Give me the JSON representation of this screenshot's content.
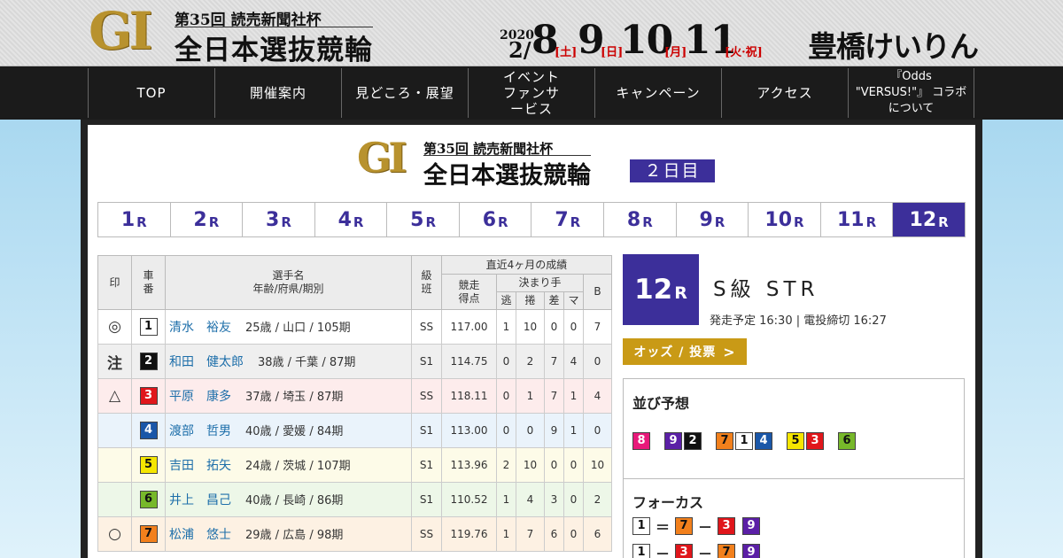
{
  "banner": {
    "gi": "GI",
    "subtitle": "第35回 読売新聞社杯",
    "title": "全日本選抜競輪",
    "year": "2020",
    "month": "2/",
    "dates": [
      {
        "num": "8",
        "day": "[土]"
      },
      {
        "num": "9",
        "day": "[日]"
      },
      {
        "num": "10",
        "day": "[月]"
      },
      {
        "num": "11",
        "day": "[火·祝]"
      }
    ],
    "brand": "豊橋けいりん"
  },
  "nav": [
    {
      "label": "TOP"
    },
    {
      "label": "開催案内"
    },
    {
      "label": "見どころ・展望"
    },
    {
      "label": "イベント ファンサービス"
    },
    {
      "label": "キャンペーン"
    },
    {
      "label": "アクセス"
    },
    {
      "label": "『Odds \"VERSUS!\"』 コラボについて"
    }
  ],
  "header": {
    "gi": "GI",
    "subtitle": "第35回 読売新聞社杯",
    "title": "全日本選抜競輪",
    "day_badge": "２日目"
  },
  "race_tabs": [
    {
      "n": "1",
      "r": "R"
    },
    {
      "n": "2",
      "r": "R"
    },
    {
      "n": "3",
      "r": "R"
    },
    {
      "n": "4",
      "r": "R"
    },
    {
      "n": "5",
      "r": "R"
    },
    {
      "n": "6",
      "r": "R"
    },
    {
      "n": "7",
      "r": "R"
    },
    {
      "n": "8",
      "r": "R"
    },
    {
      "n": "9",
      "r": "R"
    },
    {
      "n": "10",
      "r": "R"
    },
    {
      "n": "11",
      "r": "R"
    },
    {
      "n": "12",
      "r": "R"
    }
  ],
  "active_race": "12",
  "table": {
    "headers": {
      "mark": "印",
      "car": "車番",
      "name": "選手名",
      "name_sub": "年齢/府県/期別",
      "class": "級班",
      "recent": "直近4ヶ月の成績",
      "score": "競走得点",
      "kimarite": "決まり手",
      "nige": "逃",
      "makuri": "捲",
      "sashi": "差",
      "ma": "マ",
      "b": "B"
    },
    "rows": [
      {
        "mark": "◎",
        "car": "1",
        "name": "清水　裕友",
        "info": "25歳 / 山口 / 105期",
        "cls": "SS",
        "score": "117.00",
        "nige": "1",
        "makuri": "10",
        "sashi": "0",
        "ma": "0",
        "b": "7",
        "bg": "#ffffff",
        "carbg": "#ffffff",
        "carfg": "#111111"
      },
      {
        "mark": "注",
        "car": "2",
        "name": "和田　健太郎",
        "info": "38歳 / 千葉 / 87期",
        "cls": "S1",
        "score": "114.75",
        "nige": "0",
        "makuri": "2",
        "sashi": "7",
        "ma": "4",
        "b": "0",
        "bg": "#efefef",
        "carbg": "#111111",
        "carfg": "#ffffff"
      },
      {
        "mark": "△",
        "car": "3",
        "name": "平原　康多",
        "info": "37歳 / 埼玉 / 87期",
        "cls": "SS",
        "score": "118.11",
        "nige": "0",
        "makuri": "1",
        "sashi": "7",
        "ma": "1",
        "b": "4",
        "bg": "#fdecec",
        "carbg": "#e0161b",
        "carfg": "#ffffff"
      },
      {
        "mark": "",
        "car": "4",
        "name": "渡部　哲男",
        "info": "40歳 / 愛媛 / 84期",
        "cls": "S1",
        "score": "113.00",
        "nige": "0",
        "makuri": "0",
        "sashi": "9",
        "ma": "1",
        "b": "0",
        "bg": "#eaf3fb",
        "carbg": "#1a57a8",
        "carfg": "#ffffff"
      },
      {
        "mark": "",
        "car": "5",
        "name": "吉田　拓矢",
        "info": "24歳 / 茨城 / 107期",
        "cls": "S1",
        "score": "113.96",
        "nige": "2",
        "makuri": "10",
        "sashi": "0",
        "ma": "0",
        "b": "10",
        "bg": "#fdfbe8",
        "carbg": "#f5e600",
        "carfg": "#111111"
      },
      {
        "mark": "",
        "car": "6",
        "name": "井上　昌己",
        "info": "40歳 / 長崎 / 86期",
        "cls": "S1",
        "score": "110.52",
        "nige": "1",
        "makuri": "4",
        "sashi": "3",
        "ma": "0",
        "b": "2",
        "bg": "#edf7e8",
        "carbg": "#77b82a",
        "carfg": "#111111"
      },
      {
        "mark": "○",
        "car": "7",
        "name": "松浦　悠士",
        "info": "29歳 / 広島 / 98期",
        "cls": "SS",
        "score": "119.76",
        "nige": "1",
        "makuri": "7",
        "sashi": "6",
        "ma": "0",
        "b": "6",
        "bg": "#fdf1e3",
        "carbg": "#f2801c",
        "carfg": "#111111"
      }
    ]
  },
  "race_info": {
    "number": "12",
    "r": "R",
    "class": "S級 STR",
    "time": "発走予定 16:30 | 電投締切 16:27",
    "odds_label": "オッズ / 投票",
    "odds_chevron": ">"
  },
  "narabi": {
    "title": "並び予想",
    "groups": [
      [
        "8"
      ],
      [
        "9",
        "2"
      ],
      [
        "7",
        "1",
        "4"
      ],
      [
        "5",
        "3"
      ],
      [
        "6"
      ]
    ]
  },
  "focus": {
    "title": "フォーカス",
    "rows": [
      [
        "1",
        "＝",
        "7",
        "－",
        "3",
        "9"
      ],
      [
        "1",
        "－",
        "3",
        "－",
        "7",
        "9"
      ]
    ]
  },
  "colors": {
    "accent": "#3c2f9a",
    "odds": "#c99a16",
    "car": {
      "1": [
        "#ffffff",
        "#111111"
      ],
      "2": [
        "#111111",
        "#ffffff"
      ],
      "3": [
        "#e0161b",
        "#ffffff"
      ],
      "4": [
        "#1a57a8",
        "#ffffff"
      ],
      "5": [
        "#f5e600",
        "#111111"
      ],
      "6": [
        "#77b82a",
        "#111111"
      ],
      "7": [
        "#f2801c",
        "#111111"
      ],
      "8": [
        "#e8197a",
        "#ffffff"
      ],
      "9": [
        "#5b1fa6",
        "#ffffff"
      ]
    }
  }
}
